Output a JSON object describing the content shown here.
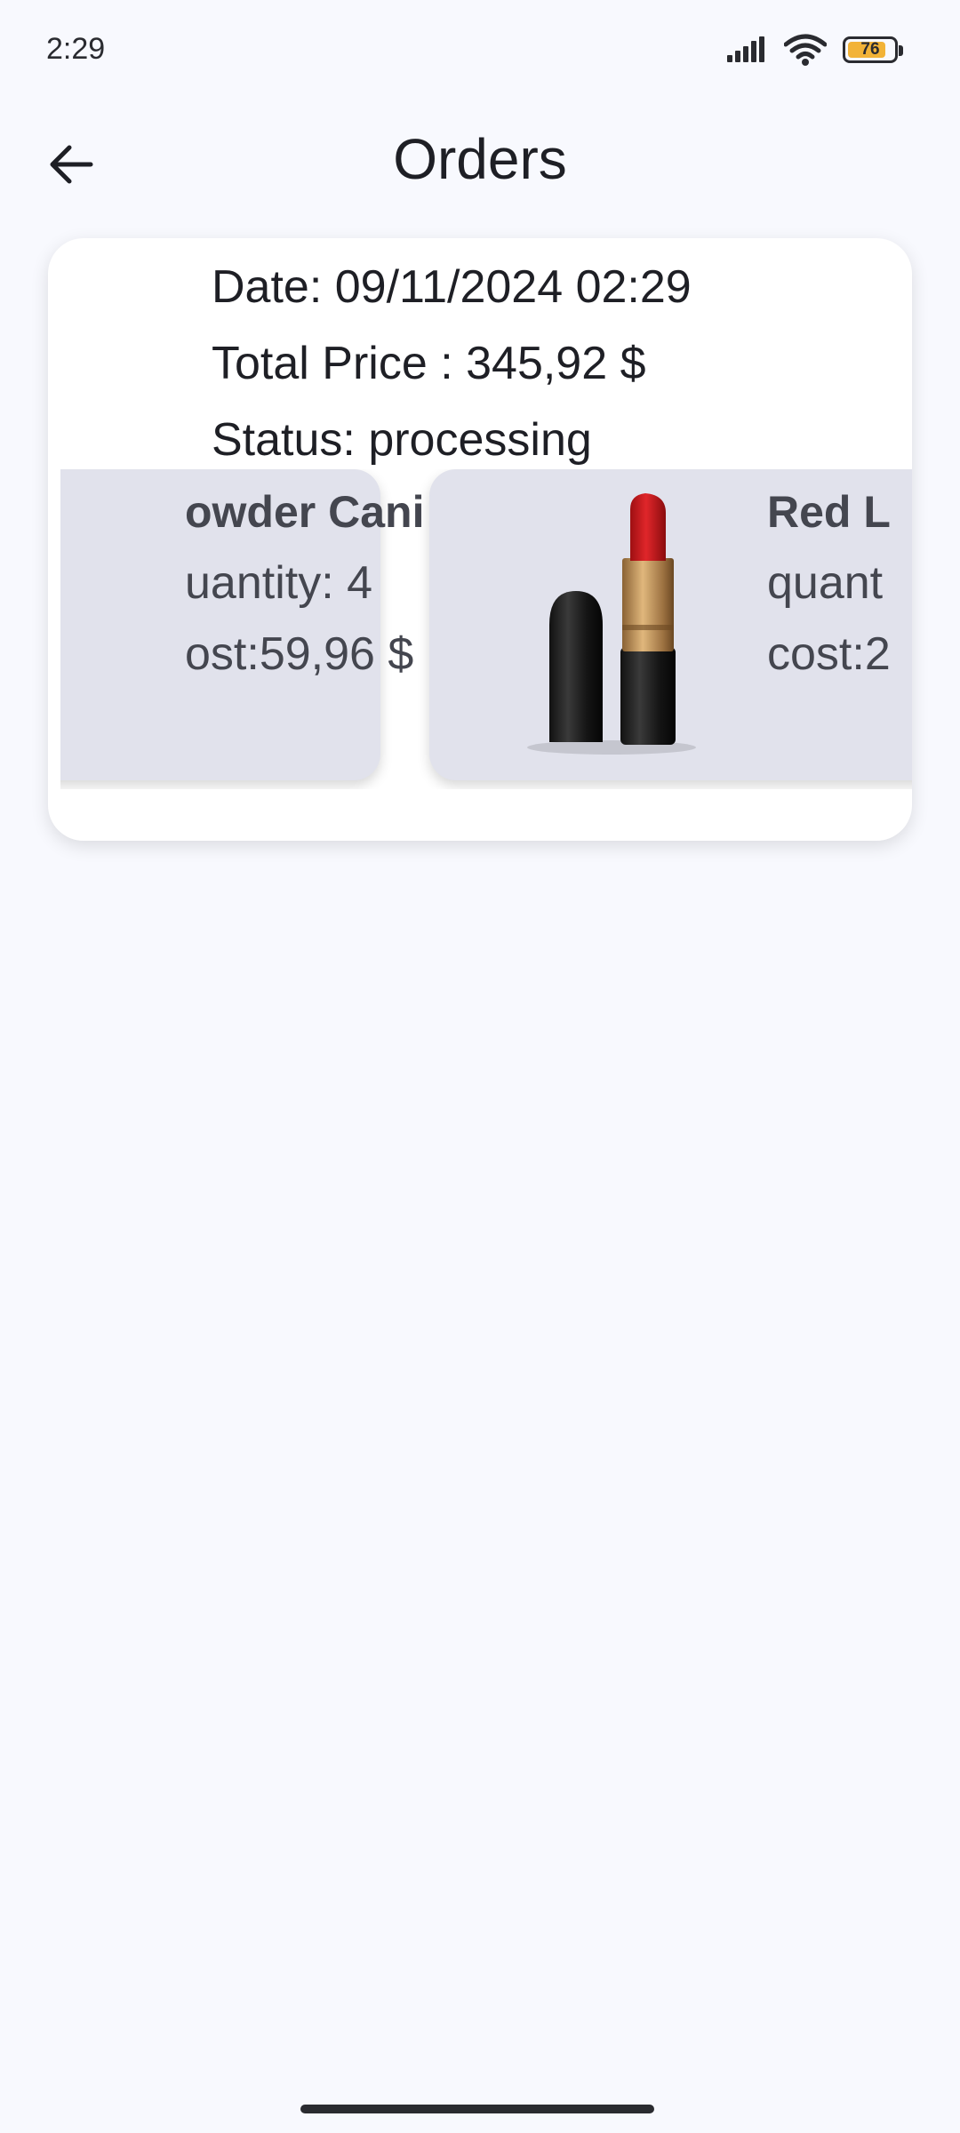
{
  "status_bar": {
    "time": "2:29",
    "battery": "76"
  },
  "header": {
    "title": "Orders"
  },
  "order": {
    "date": "Date: 09/11/2024 02:29",
    "total_price": "Total Price : 345,92 $",
    "status": "Status: processing",
    "items": [
      {
        "name": "owder Cani…",
        "quantity": "uantity: 4",
        "cost": "ost:59,96 $"
      },
      {
        "name": "Red L",
        "quantity": "quant",
        "cost": "cost:2"
      }
    ]
  },
  "colors": {
    "background": "#F8F9FE",
    "card": "#FFFFFF",
    "item_card": "#E1E2EC",
    "battery": "#F2B337"
  },
  "icons": [
    "back-arrow-icon",
    "signal-icon",
    "wifi-icon",
    "battery-icon",
    "lipstick-image"
  ]
}
